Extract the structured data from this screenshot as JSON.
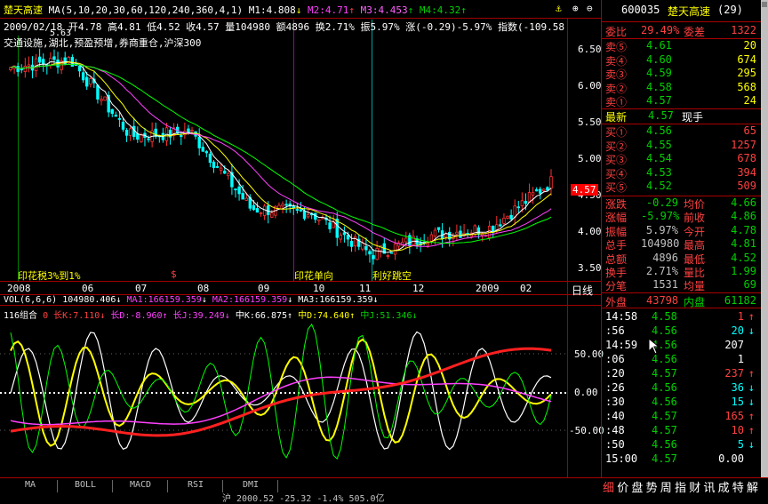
{
  "header": {
    "stock_name": "楚天高速",
    "ma_line": "MA(5,10,20,30,60,120,240,360,4,1)",
    "m1": "M1:4.808",
    "m2": "M2:4.71",
    "m3": "M3:4.453",
    "m4": "M4:4.32",
    "ohlc_line": "2009/02/18 开4.78 高4.81 低4.52 收4.57 量104980 额4896 换2.71% 振5.97% 涨(-0.29)-5.97% 指数(-109.58",
    "concepts": "交通设施,湖北,预盈预增,券商重仓,沪深300",
    "marker": "5.63"
  },
  "price_axis": [
    "6.50",
    "6.00",
    "5.50",
    "5.00",
    "4.50",
    "4.00",
    "3.50"
  ],
  "current_price_tag": "4.57",
  "annotations": [
    "印花税3%到1%",
    "印花单向",
    "利好跳空"
  ],
  "date_axis": [
    "2008",
    "06",
    "07",
    "08",
    "09",
    "10",
    "11",
    "12",
    "2009",
    "02"
  ],
  "date_mode": "日线",
  "volume_line": {
    "label": "VOL(6,6,6)",
    "vol": "104980.406",
    "ma1": "MA1:166159.359",
    "ma2": "MA2:166159.359",
    "ma3": "MA3:166159.359"
  },
  "indicator_line": {
    "label": "116组合",
    "zero": "0",
    "k_long": "长K:7.110",
    "d_long": "长D:-8.960",
    "j_long": "长J:39.249",
    "k_mid": "中K:66.875",
    "d_mid": "中D:74.640",
    "j_mid": "中J:51.346"
  },
  "indicator_axis": [
    "50.00",
    "0.00",
    "-50.00"
  ],
  "chart_data": {
    "type": "line",
    "title": "",
    "xlabel": "",
    "ylabel": "",
    "ylim": [
      3.35,
      6.7
    ],
    "x": [
      "2008",
      "06",
      "07",
      "08",
      "09",
      "10",
      "11",
      "12",
      "2009",
      "02"
    ],
    "series": [
      {
        "values": [
          6.1,
          6.2,
          5.2,
          5.25,
          4.25,
          4.2,
          3.65,
          3.9,
          4.0,
          4.6
        ]
      }
    ]
  },
  "quote": {
    "code": "600035",
    "name": "楚天高速",
    "period": "(29)",
    "webi_label": "委比",
    "webi_value": "29.49%",
    "wecha_label": "委差",
    "wecha_value": "1322",
    "sell": [
      {
        "label": "卖⑤",
        "price": "4.61",
        "vol": "20"
      },
      {
        "label": "卖④",
        "price": "4.60",
        "vol": "674"
      },
      {
        "label": "卖③",
        "price": "4.59",
        "vol": "295"
      },
      {
        "label": "卖②",
        "price": "4.58",
        "vol": "568"
      },
      {
        "label": "卖①",
        "price": "4.57",
        "vol": "24"
      }
    ],
    "latest_label": "最新",
    "latest_value": "4.57",
    "xianshou_label": "现手",
    "buy": [
      {
        "label": "买①",
        "price": "4.56",
        "vol": "65"
      },
      {
        "label": "买②",
        "price": "4.55",
        "vol": "1257"
      },
      {
        "label": "买③",
        "price": "4.54",
        "vol": "678"
      },
      {
        "label": "买④",
        "price": "4.53",
        "vol": "394"
      },
      {
        "label": "买⑤",
        "price": "4.52",
        "vol": "509"
      }
    ],
    "stats": [
      {
        "l1": "涨跌",
        "v1": "-0.29",
        "l2": "均价",
        "v2": "4.66"
      },
      {
        "l1": "涨幅",
        "v1": "-5.97%",
        "l2": "前收",
        "v2": "4.86"
      },
      {
        "l1": "振幅",
        "v1": "5.97%",
        "l2": "今开",
        "v2": "4.78"
      },
      {
        "l1": "总手",
        "v1": "104980",
        "l2": "最高",
        "v2": "4.81"
      },
      {
        "l1": "总额",
        "v1": "4896",
        "l2": "最低",
        "v2": "4.52"
      },
      {
        "l1": "换手",
        "v1": "2.71%",
        "l2": "量比",
        "v2": "1.99"
      },
      {
        "l1": "分笔",
        "v1": "1531",
        "l2": "均量",
        "v2": "69"
      }
    ],
    "waipan_label": "外盘",
    "waipan_value": "43798",
    "neipan_label": "内盘",
    "neipan_value": "61182"
  },
  "ticks": [
    {
      "time": "14:58",
      "price": "4.58",
      "vol": "1",
      "dir": "up"
    },
    {
      "time": ":56",
      "price": "4.56",
      "vol": "20",
      "dir": "down"
    },
    {
      "time": "14:59",
      "price": "4.56",
      "vol": "207",
      "dir": "none"
    },
    {
      "time": ":06",
      "price": "4.56",
      "vol": "1",
      "dir": "none"
    },
    {
      "time": ":20",
      "price": "4.57",
      "vol": "237",
      "dir": "up"
    },
    {
      "time": ":26",
      "price": "4.56",
      "vol": "36",
      "dir": "down"
    },
    {
      "time": ":30",
      "price": "4.56",
      "vol": "15",
      "dir": "down"
    },
    {
      "time": ":40",
      "price": "4.57",
      "vol": "165",
      "dir": "up"
    },
    {
      "time": ":48",
      "price": "4.57",
      "vol": "10",
      "dir": "up"
    },
    {
      "time": ":50",
      "price": "4.56",
      "vol": "5",
      "dir": "down"
    },
    {
      "time": "15:00",
      "price": "4.57",
      "vol": "0.00",
      "dir": "none"
    }
  ],
  "bottom_tabs": [
    "MA",
    "BOLL",
    "MACD",
    "RSI",
    "DMI"
  ],
  "right_tabs": [
    "细",
    "价",
    "盘",
    "势",
    "周",
    "指",
    "财",
    "讯",
    "成",
    "特",
    "解"
  ],
  "status_fragment": "沪 2000.52 -25.32 -1.4% 505.0亿"
}
